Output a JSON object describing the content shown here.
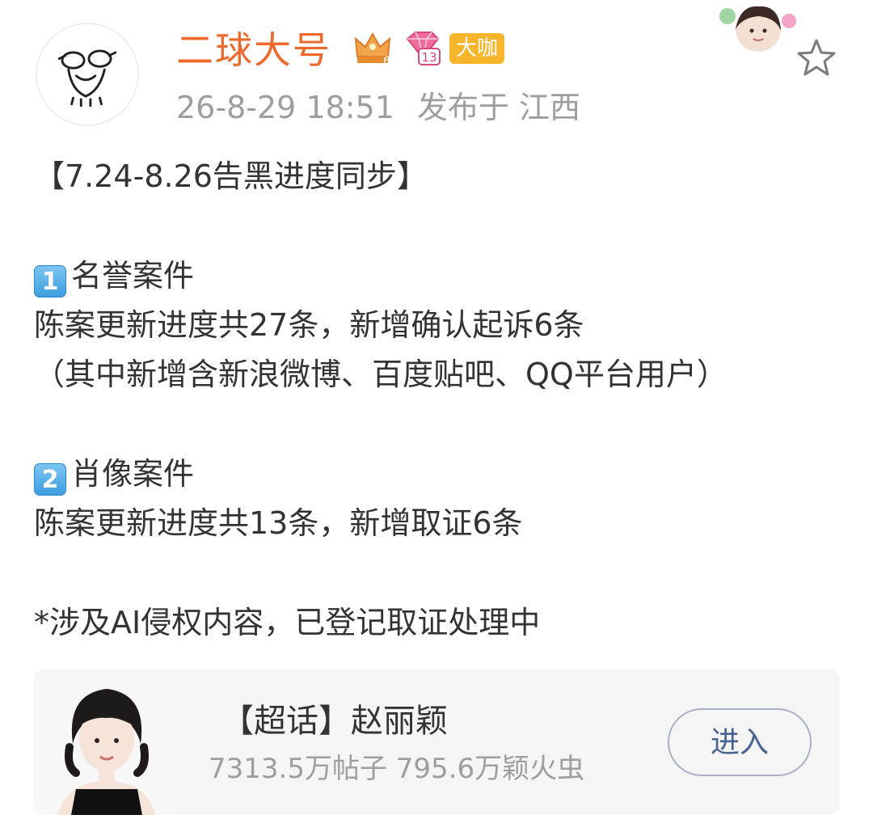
{
  "post_header": {
    "username": "二球大号",
    "level_badge": "6",
    "vip_badge": "13",
    "verified_badge": "大咖",
    "timestamp": "26-8-29 18:51",
    "location": "发布于 江西"
  },
  "post_body": {
    "lines": [
      "【7.24-8.26告黑进度同步】",
      "",
      "名誉案件",
      "陈案更新进度共27条，新增确认起诉6条",
      "（其中新增含新浪微博、百度贴吧、QQ平台用户）",
      "",
      "肖像案件",
      "陈案更新进度共13条，新增取证6条",
      "",
      "*涉及AI侵权内容，已登记取证处理中"
    ],
    "section_markers": [
      "1",
      "2"
    ]
  },
  "topic_card": {
    "title": "【超话】赵丽颖",
    "stats": "7313.5万帖子 795.6万颖火虫",
    "enter_label": "进入"
  },
  "colors": {
    "username": "#ec6a2c",
    "meta": "#9e9e9e",
    "text": "#333333",
    "card_bg": "#f5f5f5",
    "button_text": "#4a6291",
    "vip_badge": "#f7b52c"
  },
  "icons": {
    "favorite": "star-outline-icon",
    "level": "crown-icon",
    "vip": "diamond-icon"
  }
}
